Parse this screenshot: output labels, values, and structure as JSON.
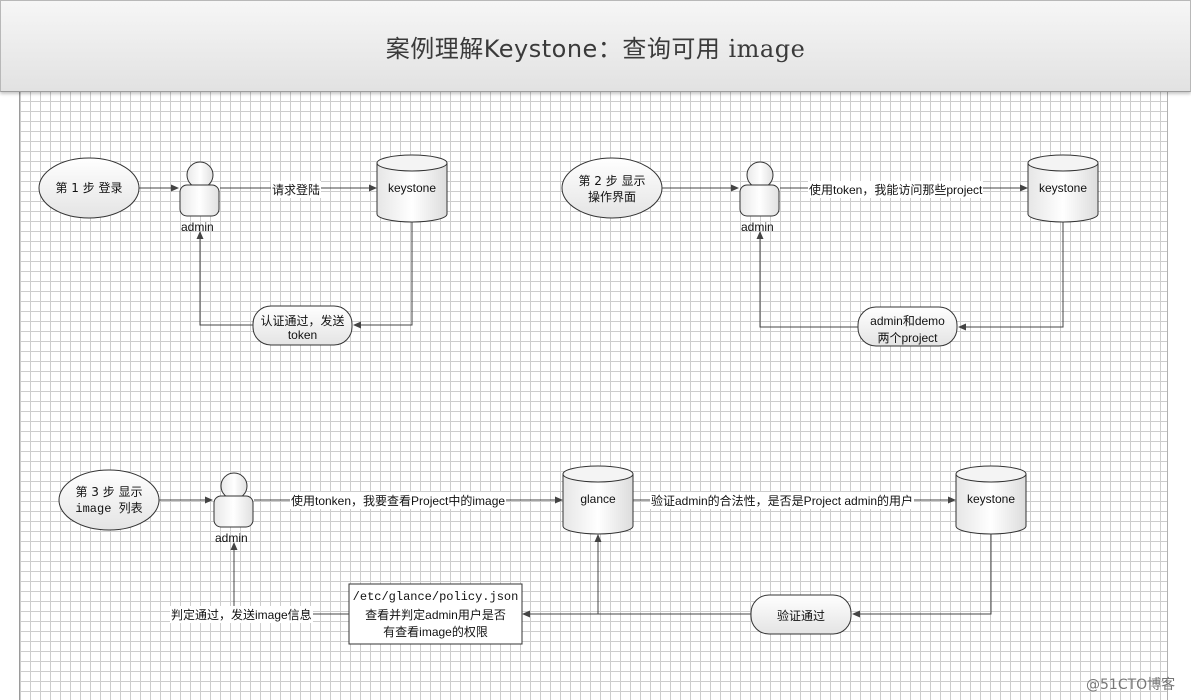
{
  "title": {
    "main": "案例理解Keystone：查询可用",
    "suffix": " image"
  },
  "step1": {
    "ellipse": "第 1 步 登录",
    "actor": "admin",
    "request": "请求登陆",
    "db": "keystone",
    "response_line1": "认证通过，发送",
    "response_line2": "token"
  },
  "step2": {
    "ellipse_line1": "第 2 步 显示",
    "ellipse_line2": "操作界面",
    "actor": "admin",
    "request": "使用token，我能访问那些project",
    "db": "keystone",
    "response_line1": "admin和demo",
    "response_line2": "两个project"
  },
  "step3": {
    "ellipse_line1": "第 3 步 显示",
    "ellipse_line2": "image 列表",
    "actor": "admin",
    "request": "使用tonken，我要查看Project中的image",
    "glance": "glance",
    "verify": "验证admin的合法性，是否是Project admin的用户",
    "db": "keystone",
    "verified": "验证通过",
    "policy_line1": "/etc/glance/policy.json",
    "policy_line2": "查看并判定admin用户是否",
    "policy_line3": "有查看image的权限",
    "result": "判定通过，发送image信息"
  },
  "watermark": "@51CTO博客"
}
